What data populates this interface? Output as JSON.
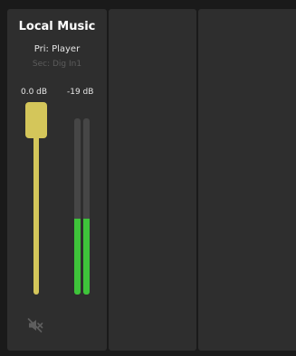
{
  "channel": {
    "title": "Local Music",
    "primary_source": "Pri: Player",
    "secondary_source": "Sec: Dig In1",
    "fader_db": "0.0 dB",
    "meter_db": "-19 dB",
    "fader_level": 0.98,
    "meter_level_left": 0.43,
    "meter_level_right": 0.43,
    "mute_icon": "speaker-muted-icon"
  },
  "colors": {
    "fader": "#d4c65a",
    "meter_fill": "#3ec43a",
    "meter_background": "#464646",
    "strip_background": "#2e2e2e",
    "app_background": "#1a1a1a"
  }
}
